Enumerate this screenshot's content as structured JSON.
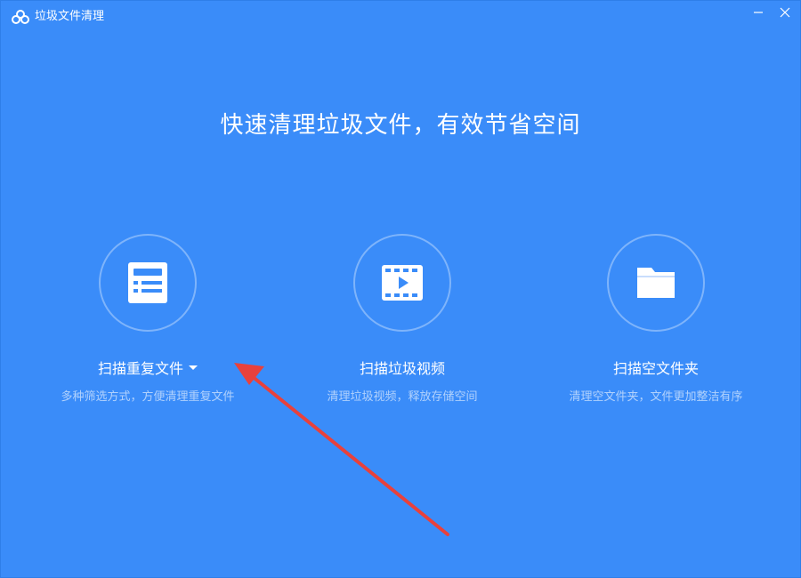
{
  "window": {
    "title": "垃圾文件清理",
    "logo_icon": "baidu-netdisk-logo-icon",
    "controls": [
      "minimize-icon",
      "close-icon"
    ]
  },
  "headline": "快速清理垃圾文件，有效节省空间",
  "features": [
    {
      "title": "扫描重复文件",
      "description": "多种筛选方式，方便清理重复文件",
      "icon": "document-list-icon",
      "has_dropdown": true
    },
    {
      "title": "扫描垃圾视频",
      "description": "清理垃圾视频，释放存储空间",
      "icon": "film-play-icon",
      "has_dropdown": false
    },
    {
      "title": "扫描空文件夹",
      "description": "清理空文件夹，文件更加整洁有序",
      "icon": "folder-icon",
      "has_dropdown": false
    }
  ],
  "colors": {
    "background": "#3a8cf9",
    "foreground": "#ffffff",
    "annotation": "#e8413c"
  }
}
